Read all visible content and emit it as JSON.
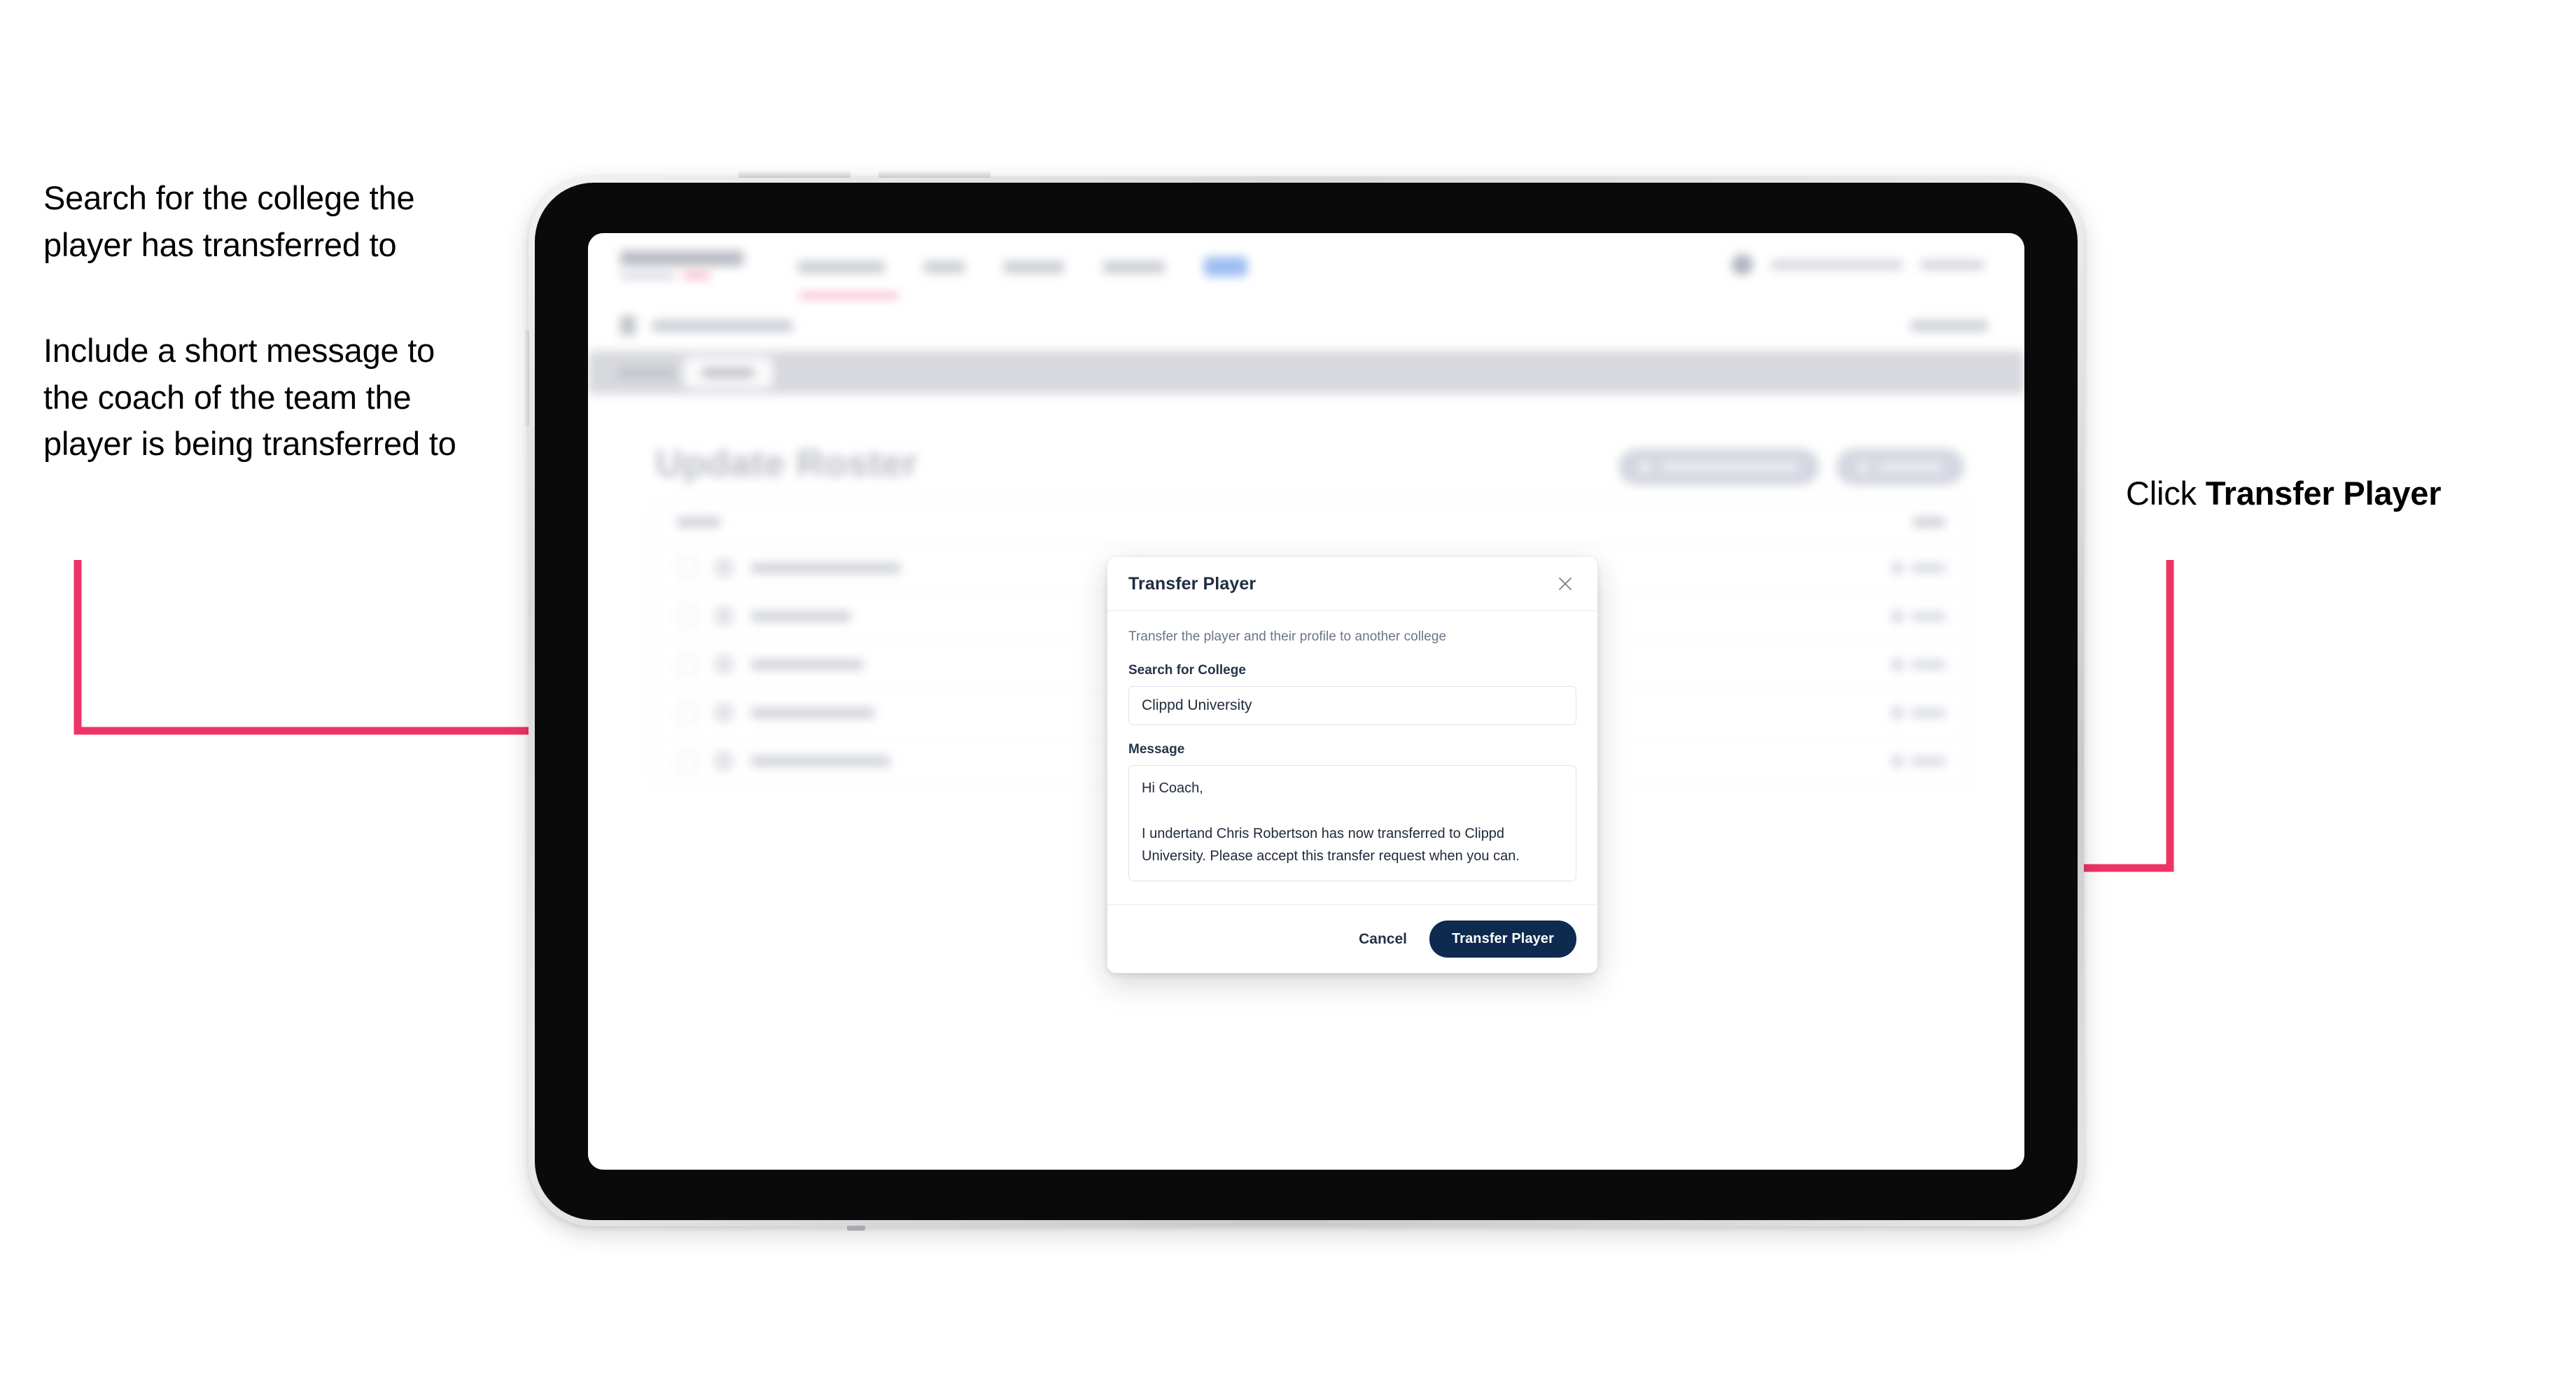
{
  "annotations": {
    "left_top": "Search for the college the player has transferred to",
    "left_bottom": "Include a short message to the coach of the team the player is being transferred to",
    "right_prefix": "Click ",
    "right_bold": "Transfer Player"
  },
  "colors": {
    "accent_pink": "#EE3465",
    "primary_navy": "#0E2A4E",
    "dialog_title": "#1F2D40",
    "muted_text": "#6A7585",
    "device_bezel": "#0A0A0A"
  },
  "app": {
    "page_title": "Update Roster"
  },
  "dialog": {
    "title": "Transfer Player",
    "close_icon": "close-icon",
    "subtitle": "Transfer the player and their profile to another college",
    "college_label": "Search for College",
    "college_value": "Clippd University",
    "college_placeholder": "Search for College",
    "message_label": "Message",
    "message_value": "Hi Coach,\n\nI undertand Chris Robertson has now transferred to Clippd University. Please accept this transfer request when you can.",
    "message_placeholder": "Message",
    "cancel_label": "Cancel",
    "submit_label": "Transfer Player"
  }
}
